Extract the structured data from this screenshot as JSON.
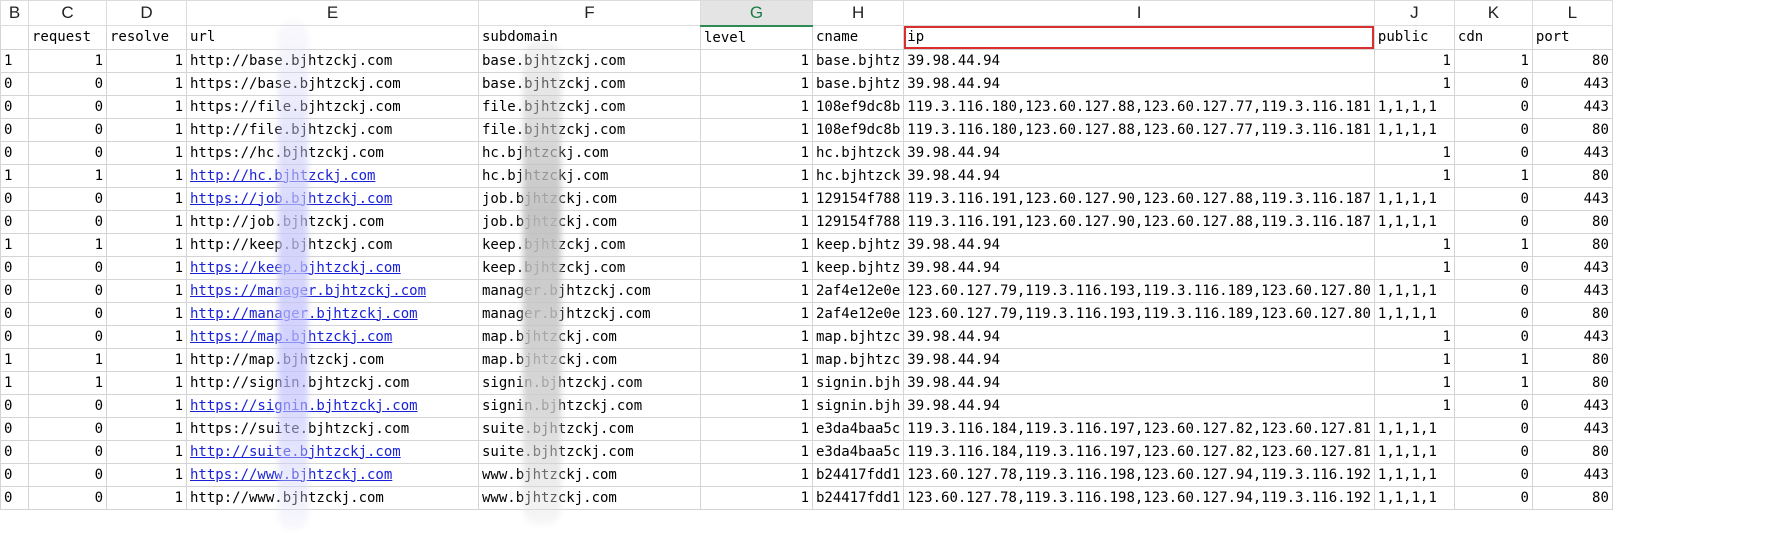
{
  "columns": [
    {
      "letter": "B",
      "selected": false
    },
    {
      "letter": "C",
      "selected": false
    },
    {
      "letter": "D",
      "selected": false
    },
    {
      "letter": "E",
      "selected": false
    },
    {
      "letter": "F",
      "selected": false
    },
    {
      "letter": "G",
      "selected": true
    },
    {
      "letter": "H",
      "selected": false
    },
    {
      "letter": "I",
      "selected": false
    },
    {
      "letter": "J",
      "selected": false
    },
    {
      "letter": "K",
      "selected": false
    },
    {
      "letter": "L",
      "selected": false
    }
  ],
  "headers": [
    "",
    "request",
    "resolve",
    "url",
    "subdomain",
    "level",
    "cname",
    "ip",
    "public",
    "cdn",
    "port"
  ],
  "rows": [
    [
      "1",
      "1",
      "1",
      "http://base.bjhtzckj.com",
      "base.bjhtzckj.com",
      "1",
      "base.bjhtz",
      "39.98.44.94",
      "1",
      "1",
      "80"
    ],
    [
      "0",
      "0",
      "1",
      "https://base.bjhtzckj.com",
      "base.bjhtzckj.com",
      "1",
      "base.bjhtz",
      "39.98.44.94",
      "1",
      "0",
      "443"
    ],
    [
      "0",
      "0",
      "1",
      "https://file.bjhtzckj.com",
      "file.bjhtzckj.com",
      "1",
      "108ef9dc8b",
      "119.3.116.180,123.60.127.88,123.60.127.77,119.3.116.181",
      "1,1,1,1",
      "0",
      "443"
    ],
    [
      "0",
      "0",
      "1",
      "http://file.bjhtzckj.com",
      "file.bjhtzckj.com",
      "1",
      "108ef9dc8b",
      "119.3.116.180,123.60.127.88,123.60.127.77,119.3.116.181",
      "1,1,1,1",
      "0",
      "80"
    ],
    [
      "0",
      "0",
      "1",
      "https://hc.bjhtzckj.com",
      "hc.bjhtzckj.com",
      "1",
      "hc.bjhtzck",
      "39.98.44.94",
      "1",
      "0",
      "443"
    ],
    [
      "1",
      "1",
      "1",
      "http://hc.bjhtzckj.com",
      "hc.bjhtzckj.com",
      "1",
      "hc.bjhtzck",
      "39.98.44.94",
      "1",
      "1",
      "80"
    ],
    [
      "0",
      "0",
      "1",
      "https://job.bjhtzckj.com",
      "job.bjhtzckj.com",
      "1",
      "129154f788",
      "119.3.116.191,123.60.127.90,123.60.127.88,119.3.116.187",
      "1,1,1,1",
      "0",
      "443"
    ],
    [
      "0",
      "0",
      "1",
      "http://job.bjhtzckj.com",
      "job.bjhtzckj.com",
      "1",
      "129154f788",
      "119.3.116.191,123.60.127.90,123.60.127.88,119.3.116.187",
      "1,1,1,1",
      "0",
      "80"
    ],
    [
      "1",
      "1",
      "1",
      "http://keep.bjhtzckj.com",
      "keep.bjhtzckj.com",
      "1",
      "keep.bjhtz",
      "39.98.44.94",
      "1",
      "1",
      "80"
    ],
    [
      "0",
      "0",
      "1",
      "https://keep.bjhtzckj.com",
      "keep.bjhtzckj.com",
      "1",
      "keep.bjhtz",
      "39.98.44.94",
      "1",
      "0",
      "443"
    ],
    [
      "0",
      "0",
      "1",
      "https://manager.bjhtzckj.com",
      "manager.bjhtzckj.com",
      "1",
      "2af4e12e0e",
      "123.60.127.79,119.3.116.193,119.3.116.189,123.60.127.80",
      "1,1,1,1",
      "0",
      "443"
    ],
    [
      "0",
      "0",
      "1",
      "http://manager.bjhtzckj.com",
      "manager.bjhtzckj.com",
      "1",
      "2af4e12e0e",
      "123.60.127.79,119.3.116.193,119.3.116.189,123.60.127.80",
      "1,1,1,1",
      "0",
      "80"
    ],
    [
      "0",
      "0",
      "1",
      "https://map.bjhtzckj.com",
      "map.bjhtzckj.com",
      "1",
      "map.bjhtzc",
      "39.98.44.94",
      "1",
      "0",
      "443"
    ],
    [
      "1",
      "1",
      "1",
      "http://map.bjhtzckj.com",
      "map.bjhtzckj.com",
      "1",
      "map.bjhtzc",
      "39.98.44.94",
      "1",
      "1",
      "80"
    ],
    [
      "1",
      "1",
      "1",
      "http://signin.bjhtzckj.com",
      "signin.bjhtzckj.com",
      "1",
      "signin.bjh",
      "39.98.44.94",
      "1",
      "1",
      "80"
    ],
    [
      "0",
      "0",
      "1",
      "https://signin.bjhtzckj.com",
      "signin.bjhtzckj.com",
      "1",
      "signin.bjh",
      "39.98.44.94",
      "1",
      "0",
      "443"
    ],
    [
      "0",
      "0",
      "1",
      "https://suite.bjhtzckj.com",
      "suite.bjhtzckj.com",
      "1",
      "e3da4baa5c",
      "119.3.116.184,119.3.116.197,123.60.127.82,123.60.127.81",
      "1,1,1,1",
      "0",
      "443"
    ],
    [
      "0",
      "0",
      "1",
      "http://suite.bjhtzckj.com",
      "suite.bjhtzckj.com",
      "1",
      "e3da4baa5c",
      "119.3.116.184,119.3.116.197,123.60.127.82,123.60.127.81",
      "1,1,1,1",
      "0",
      "80"
    ],
    [
      "0",
      "0",
      "1",
      "https://www.bjhtzckj.com",
      "www.bjhtzckj.com",
      "1",
      "b24417fdd1",
      "123.60.127.78,119.3.116.198,123.60.127.94,119.3.116.192",
      "1,1,1,1",
      "0",
      "443"
    ],
    [
      "0",
      "0",
      "1",
      "http://www.bjhtzckj.com",
      "www.bjhtzckj.com",
      "1",
      "b24417fdd1",
      "123.60.127.78,119.3.116.198,123.60.127.94,119.3.116.192",
      "1,1,1,1",
      "0",
      "80"
    ]
  ],
  "linked_rows": [
    5,
    6,
    9,
    10,
    11,
    12,
    15,
    17,
    18
  ],
  "colors": {
    "link": "#1a22d8",
    "selected_col": "#1b7d44",
    "highlight": "#d83030"
  }
}
